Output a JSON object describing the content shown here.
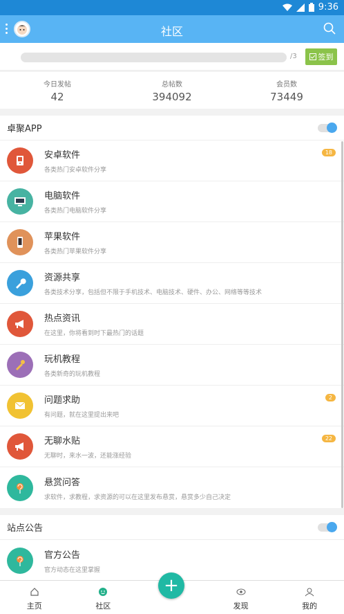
{
  "status": {
    "time": "9:36"
  },
  "appbar": {
    "title": "社区"
  },
  "signin": {
    "progress": "/3",
    "button": "签到"
  },
  "stats": [
    {
      "label": "今日发帖",
      "value": "42"
    },
    {
      "label": "总帖数",
      "value": "394092"
    },
    {
      "label": "会员数",
      "value": "73449"
    }
  ],
  "section1": {
    "title": "卓聚APP",
    "items": [
      {
        "name": "安卓软件",
        "desc": "各类热门安卓软件分享",
        "badge": "18",
        "color": "#e0573a",
        "icon": "android-phone-icon"
      },
      {
        "name": "电脑软件",
        "desc": "各类热门电脑软件分享",
        "badge": "",
        "color": "#47b3a2",
        "icon": "monitor-icon"
      },
      {
        "name": "苹果软件",
        "desc": "各类热门苹果软件分享",
        "badge": "",
        "color": "#e0925a",
        "icon": "iphone-icon"
      },
      {
        "name": "资源共享",
        "desc": "各类技术分享，包括但不限于手机技术、电脑技术、硬件、办公、网络等等技术",
        "badge": "",
        "color": "#3aa0dc",
        "icon": "wrench-icon"
      },
      {
        "name": "热点资讯",
        "desc": "在这里，你将看到时下最热门的话题",
        "badge": "",
        "color": "#e0573a",
        "icon": "megaphone-icon"
      },
      {
        "name": "玩机教程",
        "desc": "各类新奇的玩机教程",
        "badge": "",
        "color": "#9c6fb7",
        "icon": "tools-icon"
      },
      {
        "name": "问题求助",
        "desc": "有问题，就在这里提出来吧",
        "badge": "2",
        "color": "#f1c232",
        "icon": "envelope-icon"
      },
      {
        "name": "无聊水贴",
        "desc": "无聊时，来水一波，还能涨经验",
        "badge": "22",
        "color": "#e0573a",
        "icon": "megaphone-icon"
      },
      {
        "name": "悬赏问答",
        "desc": "求软件，求教程，求资源的可以在这里发布悬赏，悬赏多少自己决定",
        "badge": "",
        "color": "#2fb89d",
        "icon": "lollipop-icon"
      }
    ]
  },
  "section2": {
    "title": "站点公告",
    "items": [
      {
        "name": "官方公告",
        "desc": "官方动态在这里掌握",
        "badge": "",
        "color": "#2fb89d",
        "icon": "lollipop-icon"
      }
    ]
  },
  "tabs": [
    {
      "label": "主页",
      "icon": "home-icon"
    },
    {
      "label": "社区",
      "icon": "community-icon"
    },
    {
      "label": "",
      "icon": "spacer"
    },
    {
      "label": "发现",
      "icon": "discover-icon"
    },
    {
      "label": "我的",
      "icon": "profile-icon"
    }
  ]
}
